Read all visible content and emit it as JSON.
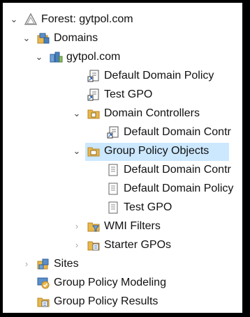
{
  "tree": {
    "forest": "Forest: gytpol.com",
    "domains": "Domains",
    "domain": "gytpol.com",
    "default_domain_policy": "Default Domain Policy",
    "test_gpo": "Test GPO",
    "domain_controllers": "Domain Controllers",
    "default_domain_controllers_link": "Default Domain Contr",
    "group_policy_objects": "Group Policy Objects",
    "gpo_default_domain_controllers": "Default Domain Contr",
    "gpo_default_domain_policy": "Default Domain Policy",
    "gpo_test_gpo": "Test GPO",
    "wmi_filters": "WMI Filters",
    "starter_gpos": "Starter GPOs",
    "sites": "Sites",
    "gp_modeling": "Group Policy Modeling",
    "gp_results": "Group Policy Results"
  },
  "colors": {
    "selection": "#cce8ff",
    "folder": "#e8b84a",
    "border": "#000000"
  },
  "icons": [
    "forest-icon",
    "domains-folder-icon",
    "domain-icon",
    "gpo-link-icon",
    "folder-icon",
    "gpo-icon",
    "wmi-filter-icon",
    "starter-gpo-icon",
    "sites-icon",
    "modeling-icon",
    "results-icon"
  ]
}
